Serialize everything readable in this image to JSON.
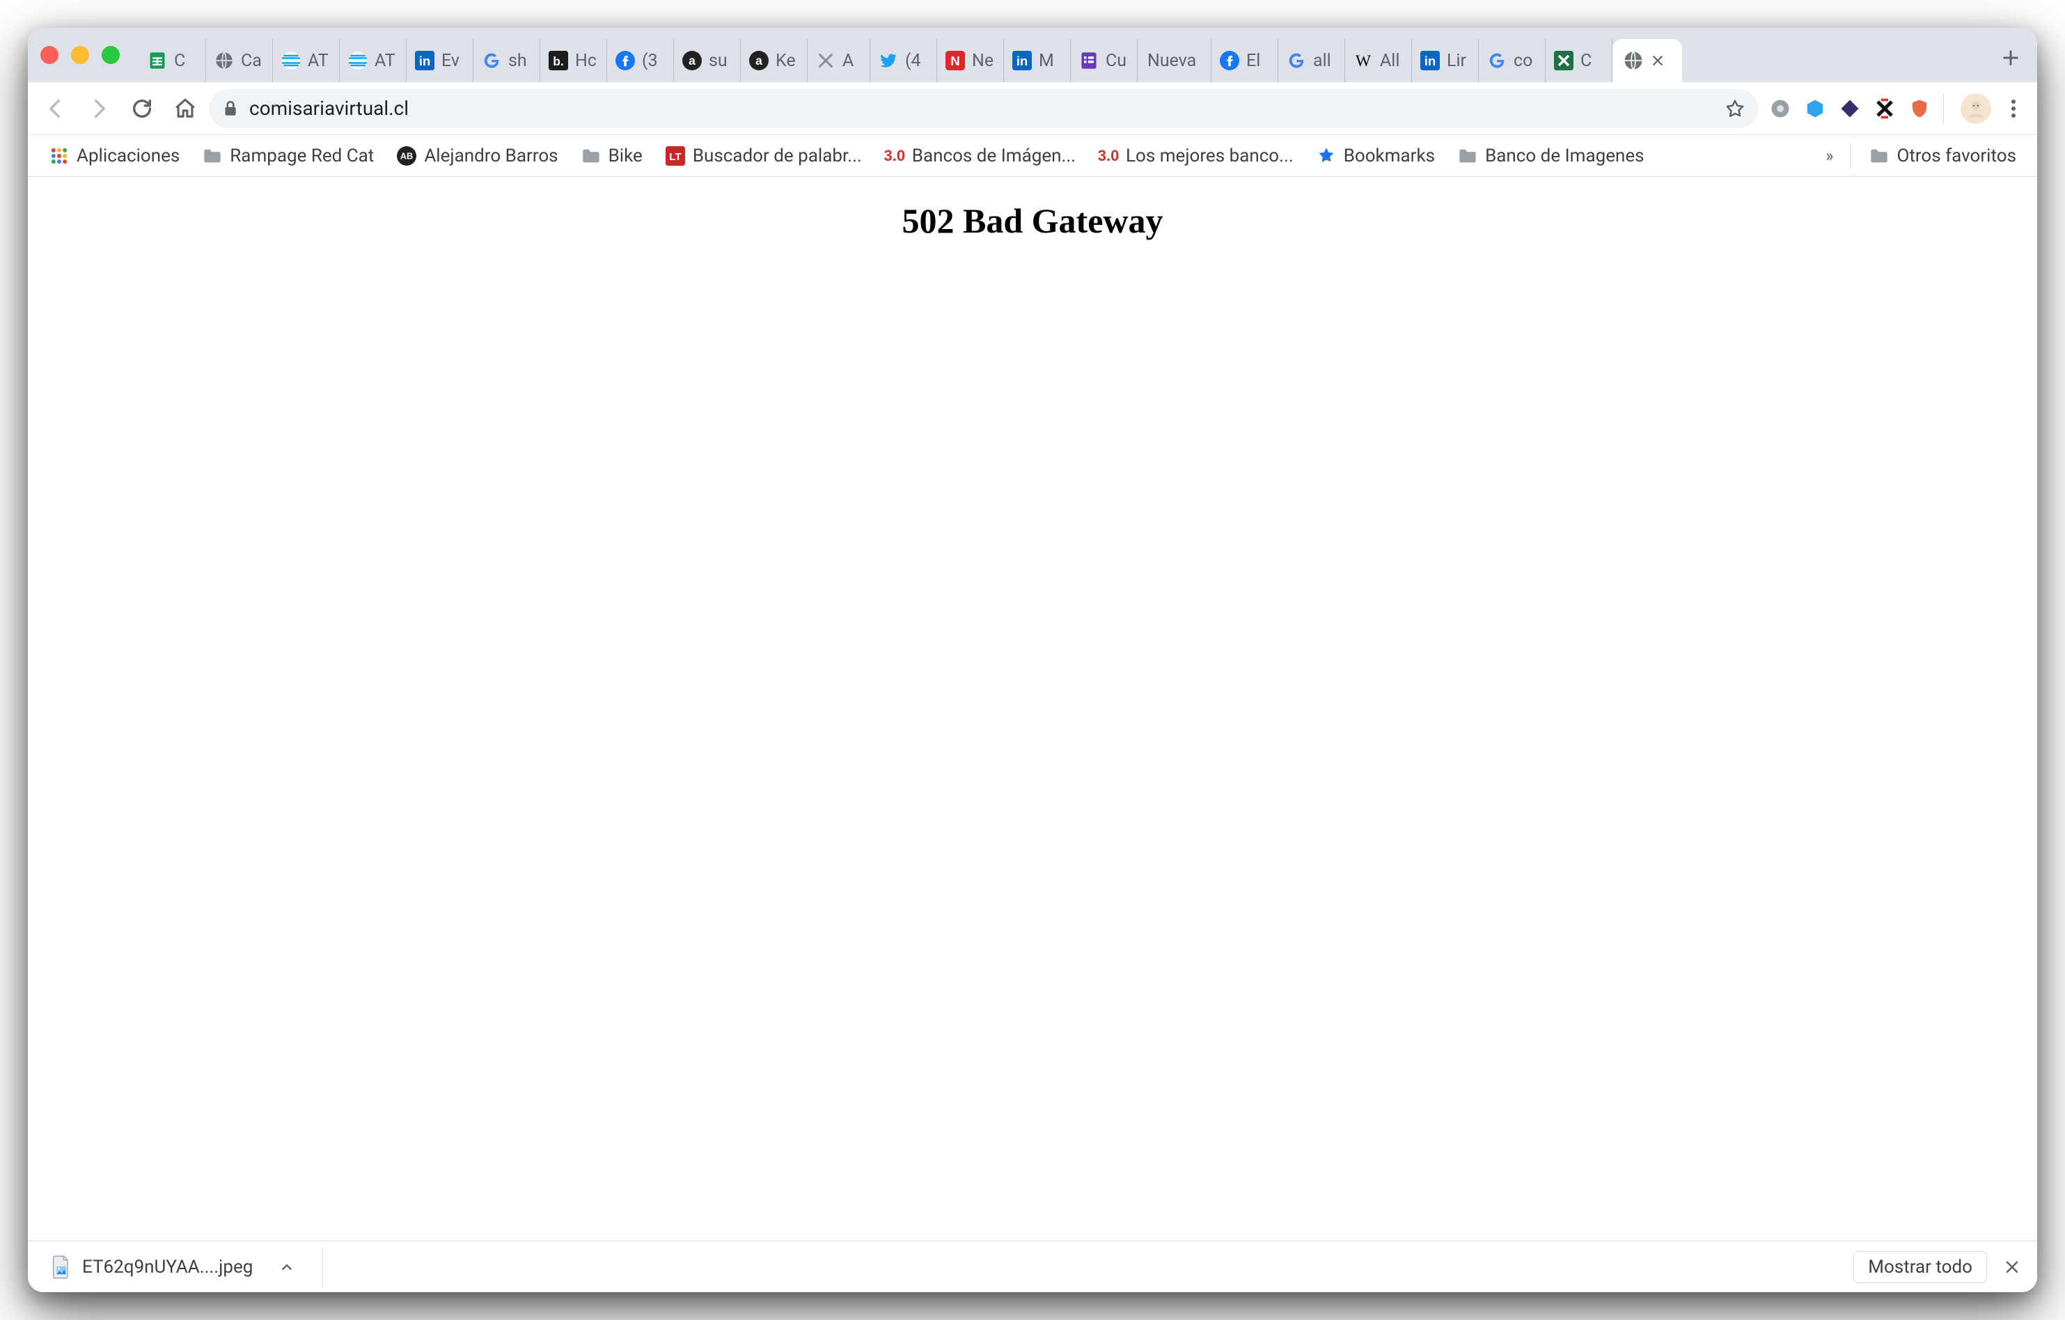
{
  "window": {
    "traffic_lights": {
      "close": "close",
      "minimize": "minimize",
      "maximize": "maximize"
    }
  },
  "tabs": [
    {
      "icon": "sheets-icon",
      "label": "C"
    },
    {
      "icon": "globe-gray-icon",
      "label": "Ca"
    },
    {
      "icon": "att-icon",
      "label": "AT"
    },
    {
      "icon": "att-icon",
      "label": "AT"
    },
    {
      "icon": "linkedin-icon",
      "label": "Ev"
    },
    {
      "icon": "google-g-icon",
      "label": "sh"
    },
    {
      "icon": "b-dark-icon",
      "label": "Hc"
    },
    {
      "icon": "facebook-icon",
      "label": "(3"
    },
    {
      "icon": "amazon-a-icon",
      "label": "su"
    },
    {
      "icon": "amazon-a-icon",
      "label": "Ke"
    },
    {
      "icon": "sketch-gray-icon",
      "label": "A"
    },
    {
      "icon": "twitter-icon",
      "label": "(4"
    },
    {
      "icon": "n-red-icon",
      "label": "Ne"
    },
    {
      "icon": "linkedin-icon",
      "label": "M"
    },
    {
      "icon": "forms-icon",
      "label": "Cu"
    },
    {
      "icon": "blank-icon",
      "label": "Nueva"
    },
    {
      "icon": "facebook-icon",
      "label": "El"
    },
    {
      "icon": "google-g-icon",
      "label": "all"
    },
    {
      "icon": "wikipedia-icon",
      "label": "All"
    },
    {
      "icon": "linkedin-icon",
      "label": "Lir"
    },
    {
      "icon": "google-g-icon",
      "label": "co"
    },
    {
      "icon": "green-x-icon",
      "label": "C"
    },
    {
      "icon": "globe-gray-icon",
      "label": "",
      "active": true
    }
  ],
  "new_tab_label": "+",
  "toolbar": {
    "back": "back",
    "forward": "forward",
    "reload": "reload",
    "home": "home",
    "lock": "secure",
    "url": "comisariavirtual.cl",
    "star": "bookmark-star"
  },
  "extensions": [
    {
      "name": "ext-circle-gray-icon"
    },
    {
      "name": "ext-blue-hex-icon"
    },
    {
      "name": "ext-purple-diamond-icon"
    },
    {
      "name": "ext-black-x-icon"
    },
    {
      "name": "ext-red-shield-icon"
    }
  ],
  "bookmarks": {
    "apps_label": "Aplicaciones",
    "items": [
      {
        "icon": "folder-icon",
        "label": "Rampage Red Cat"
      },
      {
        "icon": "ab-circle-icon",
        "label": "Alejandro Barros"
      },
      {
        "icon": "folder-icon",
        "label": "Bike"
      },
      {
        "icon": "lt-red-icon",
        "label": "Buscador de palabr..."
      },
      {
        "icon": "three-zero-icon",
        "label": "Bancos de Imágen..."
      },
      {
        "icon": "three-zero-icon",
        "label": "Los mejores banco..."
      },
      {
        "icon": "star-blue-icon",
        "label": "Bookmarks"
      },
      {
        "icon": "folder-icon",
        "label": "Banco de Imagenes"
      }
    ],
    "overflow": "»",
    "other_label": "Otros favoritos"
  },
  "page": {
    "error_heading": "502 Bad Gateway"
  },
  "downloads": {
    "file_name": "ET62q9nUYAA....jpeg",
    "show_all": "Mostrar todo"
  }
}
